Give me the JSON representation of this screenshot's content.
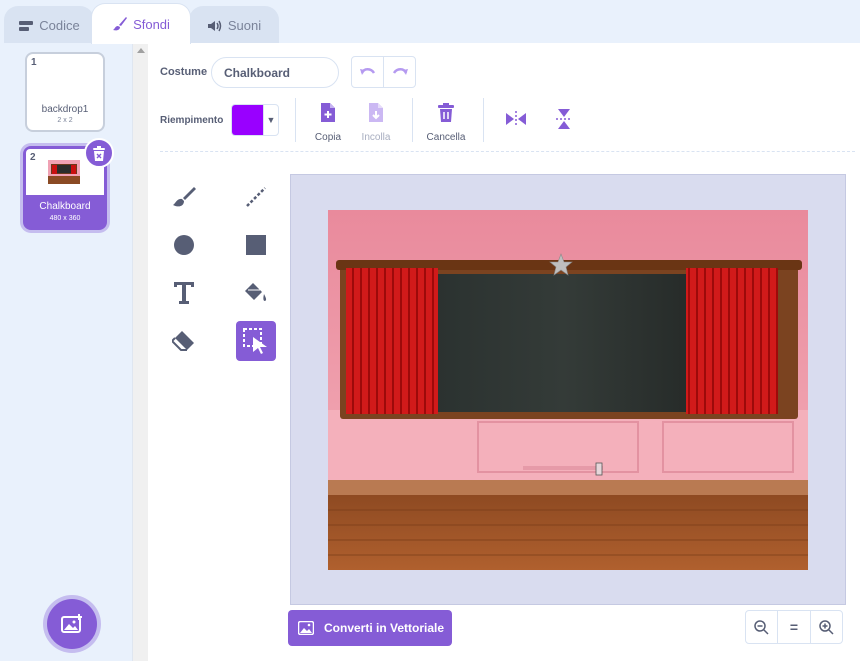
{
  "tabs": [
    {
      "label": "Codice",
      "icon": "code-icon"
    },
    {
      "label": "Sfondi",
      "icon": "brush-icon"
    },
    {
      "label": "Suoni",
      "icon": "speaker-icon"
    }
  ],
  "costumes": [
    {
      "number": "1",
      "name": "backdrop1",
      "size": "2 x 2"
    },
    {
      "number": "2",
      "name": "Chalkboard",
      "size": "480 x 360"
    }
  ],
  "editor": {
    "costume_label": "Costume",
    "costume_name": "Chalkboard",
    "fill_label": "Riempimento",
    "fill_color": "#9900ff",
    "copy_label": "Copia",
    "paste_label": "Incolla",
    "delete_label": "Cancella",
    "convert_label": "Converti in Vettoriale",
    "zoom_reset_label": "="
  },
  "colors": {
    "accent": "#855cd6",
    "text": "#575e75",
    "background": "#e9f1fc"
  }
}
